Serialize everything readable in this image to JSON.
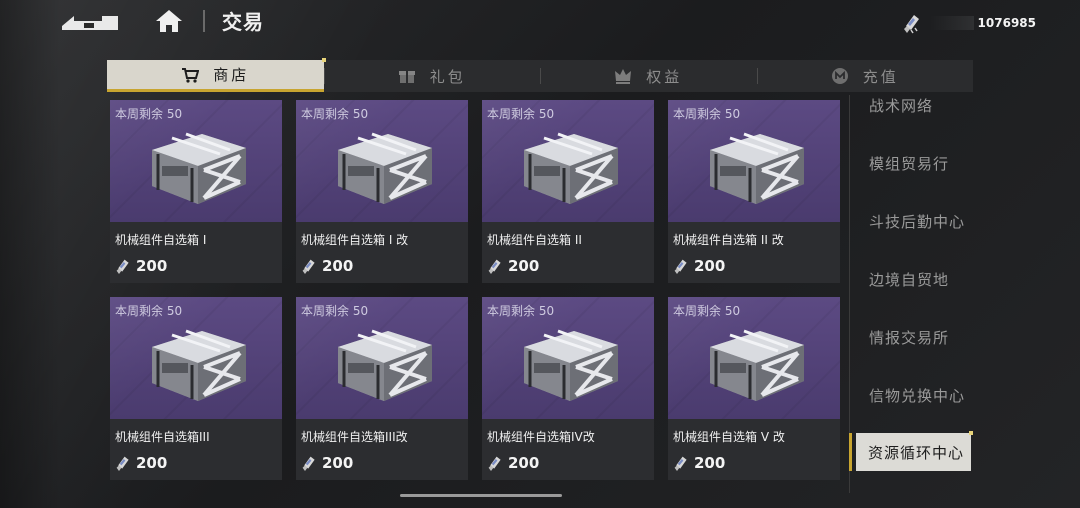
{
  "header": {
    "title": "交易",
    "back_icon": "back-arrow-icon",
    "home_icon": "home-icon",
    "currency": {
      "icon": "component-currency-icon",
      "amount": "1076985"
    }
  },
  "tabs": [
    {
      "label": "商店",
      "icon": "cart-icon",
      "active": true
    },
    {
      "label": "礼包",
      "icon": "gift-icon",
      "active": false
    },
    {
      "label": "权益",
      "icon": "crown-icon",
      "active": false
    },
    {
      "label": "充值",
      "icon": "coin-icon",
      "active": false
    }
  ],
  "products": [
    {
      "remaining": "本周剩余 50",
      "name": "机械组件自选箱 I",
      "price": "200"
    },
    {
      "remaining": "本周剩余 50",
      "name": "机械组件自选箱 I 改",
      "price": "200"
    },
    {
      "remaining": "本周剩余 50",
      "name": "机械组件自选箱 II",
      "price": "200"
    },
    {
      "remaining": "本周剩余 50",
      "name": "机械组件自选箱 II 改",
      "price": "200"
    },
    {
      "remaining": "本周剩余 50",
      "name": "机械组件自选箱III",
      "price": "200"
    },
    {
      "remaining": "本周剩余 50",
      "name": "机械组件自选箱III改",
      "price": "200"
    },
    {
      "remaining": "本周剩余 50",
      "name": "机械组件自选箱IV改",
      "price": "200"
    },
    {
      "remaining": "本周剩余 50",
      "name": "机械组件自选箱 V 改",
      "price": "200"
    }
  ],
  "sidenav": {
    "items": [
      {
        "label": "战术网络",
        "active": false
      },
      {
        "label": "模组贸易行",
        "active": false
      },
      {
        "label": "斗技后勤中心",
        "active": false
      },
      {
        "label": "边境自贸地",
        "active": false
      },
      {
        "label": "情报交易所",
        "active": false
      },
      {
        "label": "信物兑换中心",
        "active": false
      },
      {
        "label": "资源循环中心",
        "active": true
      }
    ]
  },
  "colors": {
    "accent": "#c8a530",
    "card_bg": "#5c4a83",
    "tab_active_bg": "#d9d6cc"
  }
}
